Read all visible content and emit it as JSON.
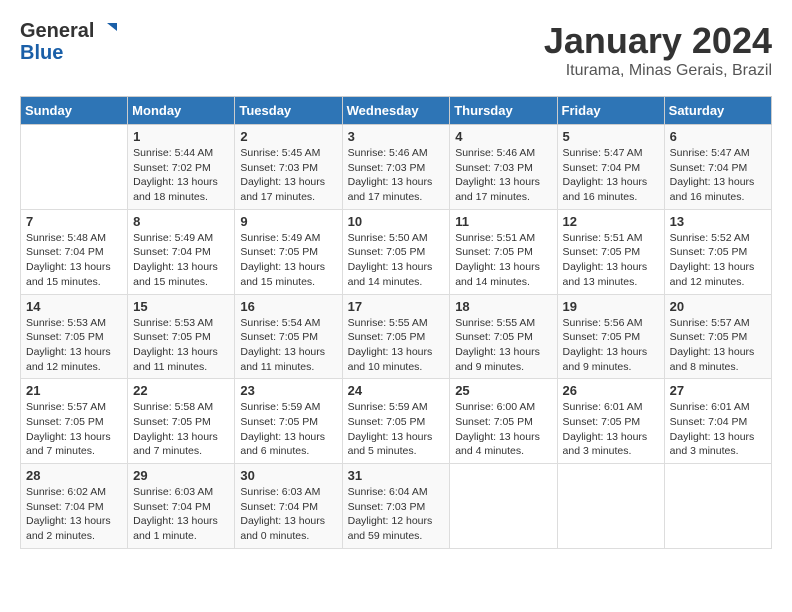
{
  "header": {
    "logo_line1": "General",
    "logo_line2": "Blue",
    "month_title": "January 2024",
    "subtitle": "Iturama, Minas Gerais, Brazil"
  },
  "days_of_week": [
    "Sunday",
    "Monday",
    "Tuesday",
    "Wednesday",
    "Thursday",
    "Friday",
    "Saturday"
  ],
  "weeks": [
    [
      {
        "day": "",
        "info": ""
      },
      {
        "day": "1",
        "info": "Sunrise: 5:44 AM\nSunset: 7:02 PM\nDaylight: 13 hours\nand 18 minutes."
      },
      {
        "day": "2",
        "info": "Sunrise: 5:45 AM\nSunset: 7:03 PM\nDaylight: 13 hours\nand 17 minutes."
      },
      {
        "day": "3",
        "info": "Sunrise: 5:46 AM\nSunset: 7:03 PM\nDaylight: 13 hours\nand 17 minutes."
      },
      {
        "day": "4",
        "info": "Sunrise: 5:46 AM\nSunset: 7:03 PM\nDaylight: 13 hours\nand 17 minutes."
      },
      {
        "day": "5",
        "info": "Sunrise: 5:47 AM\nSunset: 7:04 PM\nDaylight: 13 hours\nand 16 minutes."
      },
      {
        "day": "6",
        "info": "Sunrise: 5:47 AM\nSunset: 7:04 PM\nDaylight: 13 hours\nand 16 minutes."
      }
    ],
    [
      {
        "day": "7",
        "info": "Sunrise: 5:48 AM\nSunset: 7:04 PM\nDaylight: 13 hours\nand 15 minutes."
      },
      {
        "day": "8",
        "info": "Sunrise: 5:49 AM\nSunset: 7:04 PM\nDaylight: 13 hours\nand 15 minutes."
      },
      {
        "day": "9",
        "info": "Sunrise: 5:49 AM\nSunset: 7:05 PM\nDaylight: 13 hours\nand 15 minutes."
      },
      {
        "day": "10",
        "info": "Sunrise: 5:50 AM\nSunset: 7:05 PM\nDaylight: 13 hours\nand 14 minutes."
      },
      {
        "day": "11",
        "info": "Sunrise: 5:51 AM\nSunset: 7:05 PM\nDaylight: 13 hours\nand 14 minutes."
      },
      {
        "day": "12",
        "info": "Sunrise: 5:51 AM\nSunset: 7:05 PM\nDaylight: 13 hours\nand 13 minutes."
      },
      {
        "day": "13",
        "info": "Sunrise: 5:52 AM\nSunset: 7:05 PM\nDaylight: 13 hours\nand 12 minutes."
      }
    ],
    [
      {
        "day": "14",
        "info": "Sunrise: 5:53 AM\nSunset: 7:05 PM\nDaylight: 13 hours\nand 12 minutes."
      },
      {
        "day": "15",
        "info": "Sunrise: 5:53 AM\nSunset: 7:05 PM\nDaylight: 13 hours\nand 11 minutes."
      },
      {
        "day": "16",
        "info": "Sunrise: 5:54 AM\nSunset: 7:05 PM\nDaylight: 13 hours\nand 11 minutes."
      },
      {
        "day": "17",
        "info": "Sunrise: 5:55 AM\nSunset: 7:05 PM\nDaylight: 13 hours\nand 10 minutes."
      },
      {
        "day": "18",
        "info": "Sunrise: 5:55 AM\nSunset: 7:05 PM\nDaylight: 13 hours\nand 9 minutes."
      },
      {
        "day": "19",
        "info": "Sunrise: 5:56 AM\nSunset: 7:05 PM\nDaylight: 13 hours\nand 9 minutes."
      },
      {
        "day": "20",
        "info": "Sunrise: 5:57 AM\nSunset: 7:05 PM\nDaylight: 13 hours\nand 8 minutes."
      }
    ],
    [
      {
        "day": "21",
        "info": "Sunrise: 5:57 AM\nSunset: 7:05 PM\nDaylight: 13 hours\nand 7 minutes."
      },
      {
        "day": "22",
        "info": "Sunrise: 5:58 AM\nSunset: 7:05 PM\nDaylight: 13 hours\nand 7 minutes."
      },
      {
        "day": "23",
        "info": "Sunrise: 5:59 AM\nSunset: 7:05 PM\nDaylight: 13 hours\nand 6 minutes."
      },
      {
        "day": "24",
        "info": "Sunrise: 5:59 AM\nSunset: 7:05 PM\nDaylight: 13 hours\nand 5 minutes."
      },
      {
        "day": "25",
        "info": "Sunrise: 6:00 AM\nSunset: 7:05 PM\nDaylight: 13 hours\nand 4 minutes."
      },
      {
        "day": "26",
        "info": "Sunrise: 6:01 AM\nSunset: 7:05 PM\nDaylight: 13 hours\nand 3 minutes."
      },
      {
        "day": "27",
        "info": "Sunrise: 6:01 AM\nSunset: 7:04 PM\nDaylight: 13 hours\nand 3 minutes."
      }
    ],
    [
      {
        "day": "28",
        "info": "Sunrise: 6:02 AM\nSunset: 7:04 PM\nDaylight: 13 hours\nand 2 minutes."
      },
      {
        "day": "29",
        "info": "Sunrise: 6:03 AM\nSunset: 7:04 PM\nDaylight: 13 hours\nand 1 minute."
      },
      {
        "day": "30",
        "info": "Sunrise: 6:03 AM\nSunset: 7:04 PM\nDaylight: 13 hours\nand 0 minutes."
      },
      {
        "day": "31",
        "info": "Sunrise: 6:04 AM\nSunset: 7:03 PM\nDaylight: 12 hours\nand 59 minutes."
      },
      {
        "day": "",
        "info": ""
      },
      {
        "day": "",
        "info": ""
      },
      {
        "day": "",
        "info": ""
      }
    ]
  ]
}
